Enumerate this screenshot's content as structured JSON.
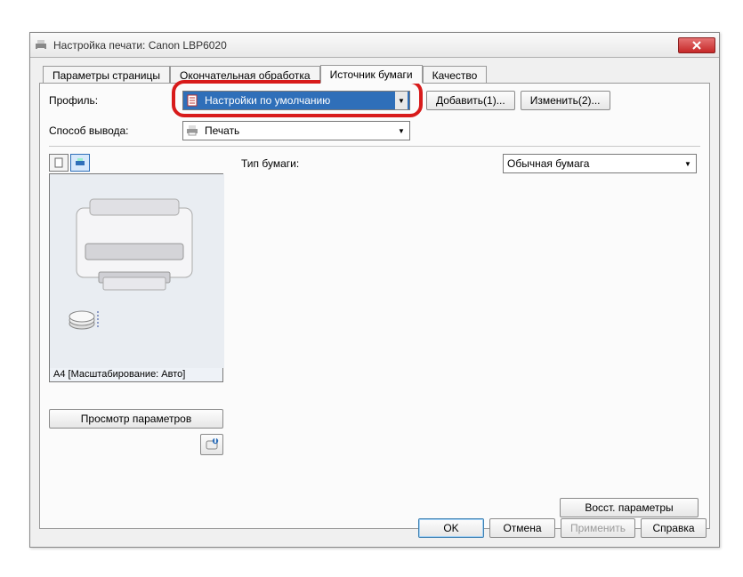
{
  "window": {
    "title": "Настройка печати: Canon LBP6020"
  },
  "tabs": [
    {
      "label": "Параметры страницы"
    },
    {
      "label": "Окончательная обработка"
    },
    {
      "label": "Источник бумаги"
    },
    {
      "label": "Качество"
    }
  ],
  "activeTab": 2,
  "profile": {
    "label": "Профиль:",
    "value": "Настройки по умолчанию",
    "addBtn": "Добавить(1)...",
    "editBtn": "Изменить(2)..."
  },
  "output": {
    "label": "Способ вывода:",
    "value": "Печать"
  },
  "paperType": {
    "label": "Тип бумаги:",
    "value": "Обычная бумага"
  },
  "preview": {
    "caption": "A4 [Масштабирование: Авто]"
  },
  "viewParamsBtn": "Просмотр параметров",
  "restoreBtn": "Восст. параметры",
  "footer": {
    "ok": "OK",
    "cancel": "Отмена",
    "apply": "Применить",
    "help": "Справка"
  }
}
